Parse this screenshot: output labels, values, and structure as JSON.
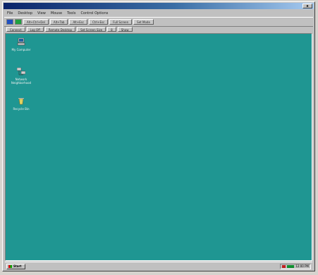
{
  "window": {
    "title": "",
    "close_label": "x"
  },
  "menu": [
    "File",
    "Desktop",
    "View",
    "Mouse",
    "Tools",
    "Control Options"
  ],
  "toolbar": {
    "buttons": [
      "Alt+Ctrl+Del",
      "Alt+Tab",
      "Alt+Esc",
      "Ctrl+Esc",
      "Full Screen",
      "Set Mode"
    ]
  },
  "subbar": {
    "buttons": [
      "Connect",
      "Log Off",
      "Remote Desktop",
      "Set Screen Size",
      "8",
      "Show"
    ]
  },
  "desktop": {
    "background": "#1f9692",
    "icons": [
      {
        "label": "My Computer",
        "icon": "computer-icon"
      },
      {
        "label": "Network Neighborhood",
        "icon": "network-icon"
      },
      {
        "label": "Recycle Bin",
        "icon": "recycle-bin-icon"
      }
    ]
  },
  "taskbar": {
    "start_label": "Start",
    "clock": "12:00 PM"
  }
}
